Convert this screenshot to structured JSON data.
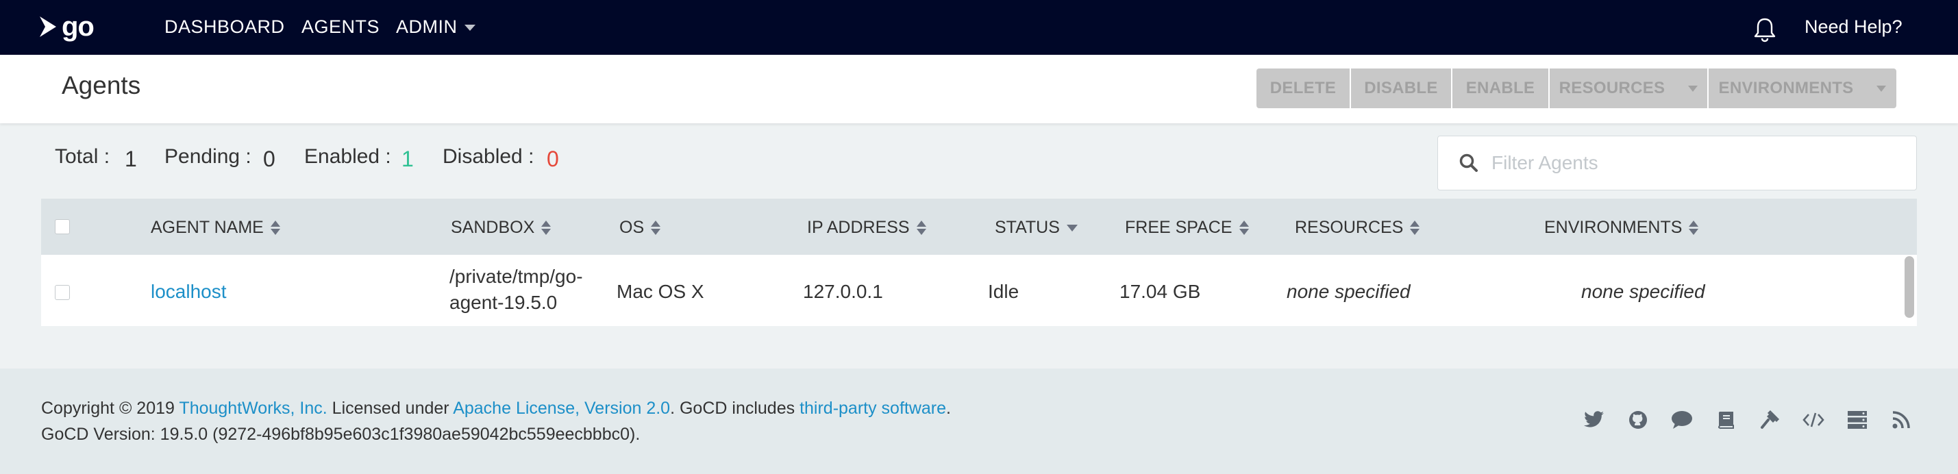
{
  "nav": {
    "logo_text": "go",
    "items": [
      {
        "label": "DASHBOARD"
      },
      {
        "label": "AGENTS"
      },
      {
        "label": "ADMIN"
      }
    ],
    "help_label": "Need Help?",
    "icons": [
      "play-logo-icon",
      "caret-down-icon",
      "bell-icon"
    ]
  },
  "header": {
    "title": "Agents",
    "buttons": {
      "delete": "DELETE",
      "disable": "DISABLE",
      "enable": "ENABLE",
      "resources": "RESOURCES",
      "environments": "ENVIRONMENTS"
    }
  },
  "stats": {
    "total_label": "Total :",
    "total": "1",
    "pending_label": "Pending :",
    "pending": "0",
    "enabled_label": "Enabled :",
    "enabled": "1",
    "disabled_label": "Disabled :",
    "disabled": "0",
    "colors": {
      "enabled": "#2fc193",
      "disabled": "#e5493a"
    }
  },
  "filter": {
    "placeholder": "Filter Agents",
    "value": ""
  },
  "table": {
    "columns": [
      "AGENT NAME",
      "SANDBOX",
      "OS",
      "IP ADDRESS",
      "STATUS",
      "FREE SPACE",
      "RESOURCES",
      "ENVIRONMENTS"
    ],
    "rows": [
      {
        "agent_name": "localhost",
        "sandbox_line1": "/private/tmp/go-",
        "sandbox_line2": "agent-19.5.0",
        "os": "Mac OS X",
        "ip_address": "127.0.0.1",
        "status": "Idle",
        "free_space": "17.04 GB",
        "resources": "none specified",
        "environments": "none specified"
      }
    ]
  },
  "footer": {
    "copyright_prefix": "Copyright © 2019 ",
    "company_link": "ThoughtWorks, Inc.",
    "licensed_text": " Licensed under ",
    "license_link": "Apache License, Version 2.0",
    "includes_text": ". GoCD includes ",
    "third_party_link": "third-party software",
    "period": ".",
    "version": "GoCD Version: 19.5.0 (9272-496bf8b95e603c1f3980ae59042bc559eecbbbc0).",
    "icons": [
      "twitter-icon",
      "github-icon",
      "chat-icon",
      "book-icon",
      "plugin-icon",
      "code-icon",
      "server-icon",
      "rss-icon"
    ]
  },
  "colors": {
    "nav_bg": "#000728",
    "link": "#1c8fc8",
    "button_disabled": "#c8c8c8"
  }
}
